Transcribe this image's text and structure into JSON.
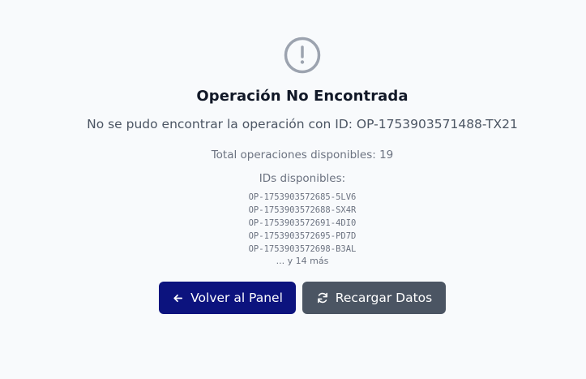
{
  "icons": {
    "alert": "alert-circle-icon",
    "back": "arrow-left-icon",
    "reload": "refresh-icon"
  },
  "colors": {
    "background": "#f8fafc",
    "icon": "#9ca3af",
    "primary_button": "#0c137e",
    "secondary_button": "#4b5563"
  },
  "error": {
    "title": "Operación No Encontrada",
    "message": "No se pudo encontrar la operación con ID: OP-1753903571488-TX21",
    "total": "Total operaciones disponibles: 19",
    "ids_label": "IDs disponibles:",
    "ids": [
      "OP-1753903572685-5LV6",
      "OP-1753903572688-SX4R",
      "OP-1753903572691-4DI0",
      "OP-1753903572695-PD7D",
      "OP-1753903572698-B3AL"
    ],
    "more": "... y 14 más"
  },
  "actions": {
    "back_label": "Volver al Panel",
    "reload_label": "Recargar Datos"
  }
}
